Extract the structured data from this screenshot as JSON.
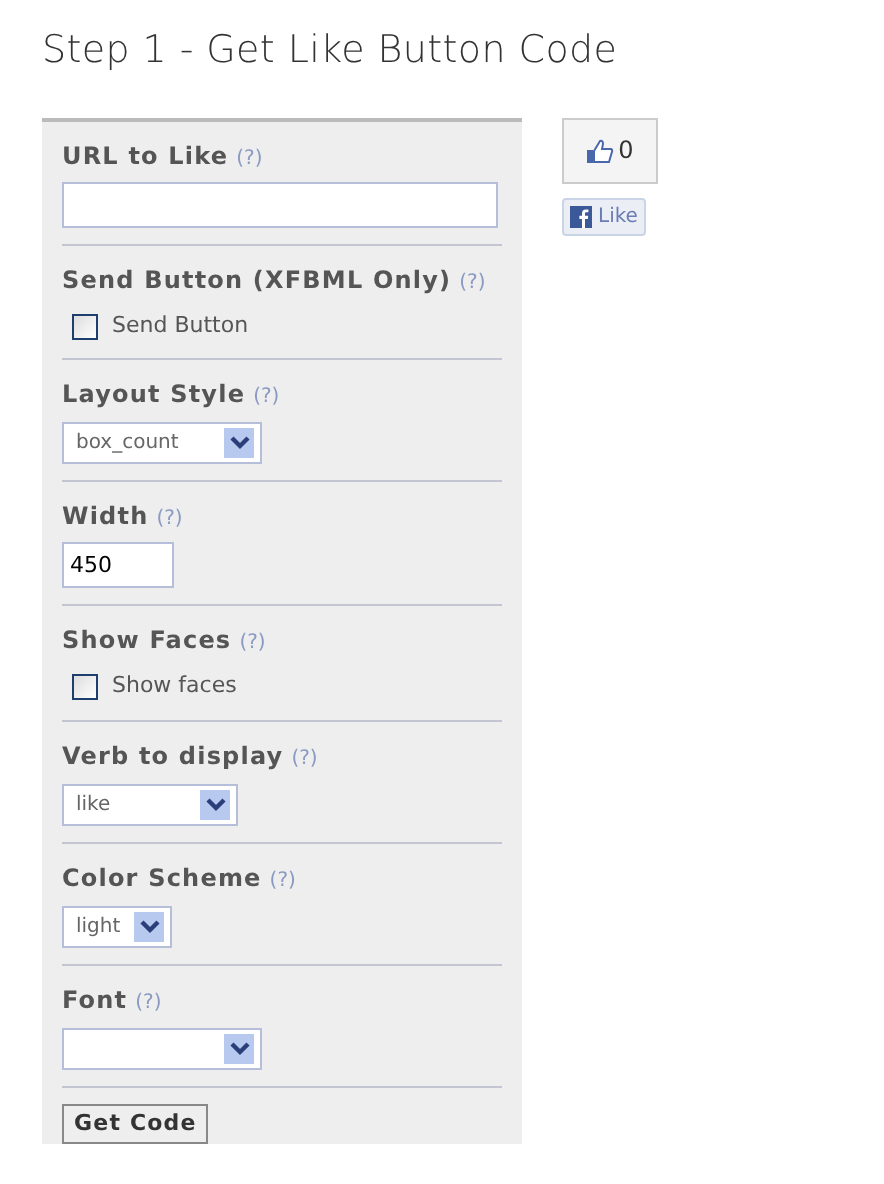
{
  "heading": "Step 1 - Get Like Button Code",
  "fields": [
    {
      "kind": "text",
      "label": "URL to Like",
      "help": "(?)"
    },
    {
      "kind": "checkbox",
      "label": "Send Button (XFBML Only)",
      "help": "(?)",
      "option": "Send Button",
      "checked": false
    },
    {
      "kind": "select",
      "label": "Layout Style",
      "help": "(?)",
      "value": "box_count"
    },
    {
      "kind": "text",
      "label": "Width",
      "help": "(?)",
      "value": "450"
    },
    {
      "kind": "checkbox",
      "label": "Show Faces",
      "help": "(?)",
      "option": "Show faces",
      "checked": false
    },
    {
      "kind": "select",
      "label": "Verb to display",
      "help": "(?)",
      "value": "like"
    },
    {
      "kind": "select",
      "label": "Color Scheme",
      "help": "(?)",
      "value": "light"
    },
    {
      "kind": "select",
      "label": "Font",
      "help": "(?)"
    }
  ],
  "submit": "Get Code",
  "preview": {
    "count": "0",
    "button": "Like"
  }
}
